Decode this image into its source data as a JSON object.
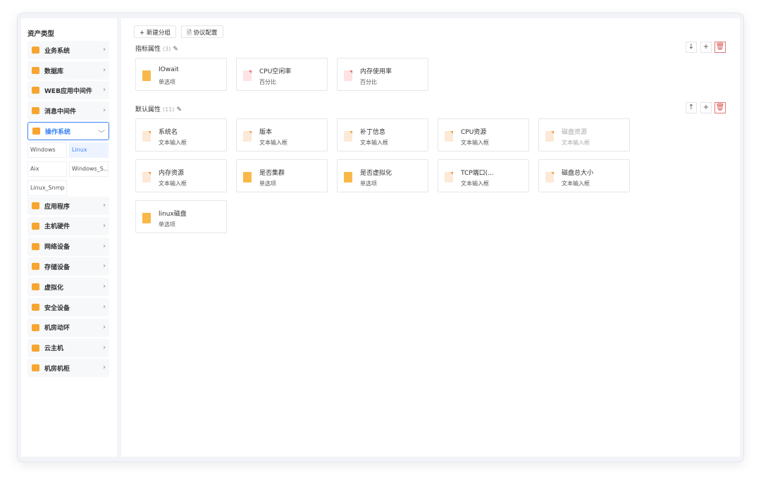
{
  "sidebar": {
    "title": "资产类型",
    "items_top": [
      {
        "label": "业务系统",
        "icon": "business-system-icon"
      },
      {
        "label": "数据库",
        "icon": "database-icon"
      },
      {
        "label": "WEB应用中间件",
        "icon": "web-middleware-icon"
      },
      {
        "label": "消息中间件",
        "icon": "message-middleware-icon"
      },
      {
        "label": "操作系统",
        "icon": "os-icon",
        "active": true
      }
    ],
    "sub_items": [
      "Windows",
      "Linux",
      "Aix",
      "Windows_S...",
      "Linux_Snmp"
    ],
    "selected_sub": "Linux",
    "items_bottom": [
      {
        "label": "应用程序",
        "icon": "application-icon"
      },
      {
        "label": "主机硬件",
        "icon": "host-hardware-icon"
      },
      {
        "label": "网络设备",
        "icon": "network-device-icon"
      },
      {
        "label": "存储设备",
        "icon": "storage-device-icon"
      },
      {
        "label": "虚拟化",
        "icon": "virtualization-icon"
      },
      {
        "label": "安全设备",
        "icon": "security-device-icon"
      },
      {
        "label": "机房动环",
        "icon": "room-environment-icon"
      },
      {
        "label": "云主机",
        "icon": "cloud-host-icon"
      },
      {
        "label": "机房机柜",
        "icon": "cabinet-icon"
      }
    ]
  },
  "toolbar": {
    "new_group": "+ 新建分组",
    "protocol": "协议配置"
  },
  "sections": [
    {
      "title": "指标属性",
      "count": "(3)",
      "cards": [
        {
          "name": "IOwait",
          "type": "单选项",
          "icon": "list"
        },
        {
          "name": "CPU空闲率",
          "type": "百分比",
          "icon": "pct"
        },
        {
          "name": "内存使用率",
          "type": "百分比",
          "icon": "pct"
        }
      ]
    },
    {
      "title": "默认属性",
      "count": "(11)",
      "cards": [
        {
          "name": "系统名",
          "type": "文本输入框",
          "icon": "text"
        },
        {
          "name": "版本",
          "type": "文本输入框",
          "icon": "text"
        },
        {
          "name": "补丁信息",
          "type": "文本输入框",
          "icon": "text"
        },
        {
          "name": "CPU资源",
          "type": "文本输入框",
          "icon": "text"
        },
        {
          "name": "磁盘资源",
          "type": "文本输入框",
          "icon": "text",
          "disabled": true
        },
        {
          "name": "内存资源",
          "type": "文本输入框",
          "icon": "text"
        },
        {
          "name": "是否集群",
          "type": "单选项",
          "icon": "list"
        },
        {
          "name": "是否虚拟化",
          "type": "单选项",
          "icon": "list"
        },
        {
          "name": "TCP端口(...",
          "type": "文本输入框",
          "icon": "text"
        },
        {
          "name": "磁盘总大小",
          "type": "文本输入框",
          "icon": "text"
        },
        {
          "name": "linux磁盘",
          "type": "单选项",
          "icon": "list"
        }
      ]
    }
  ],
  "colors": {
    "accent": "#3b82f6",
    "icon_orange": "#f7a531",
    "danger": "#d9534f"
  }
}
